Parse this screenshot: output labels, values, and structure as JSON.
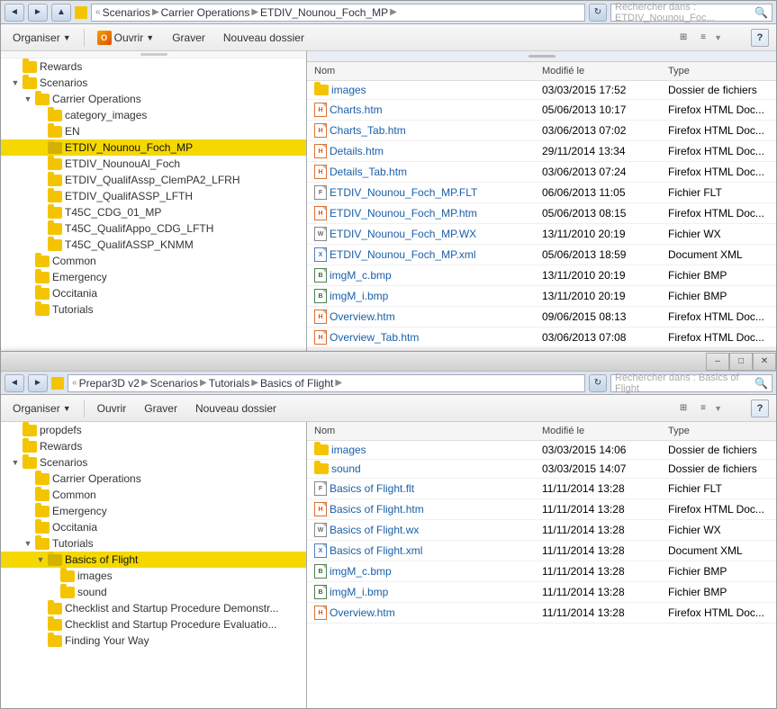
{
  "window1": {
    "addr": {
      "part1": "Scenarios",
      "part2": "Carrier Operations",
      "part3": "ETDIV_Nounou_Foch_MP",
      "search_placeholder": "Rechercher dans : ETDIV_Nounou_Foc..."
    },
    "toolbar": {
      "organiser": "Organiser",
      "ouvrir": "Ouvrir",
      "graver": "Graver",
      "nouveau_dossier": "Nouveau dossier"
    },
    "tree": {
      "items": [
        {
          "label": "Rewards",
          "indent": 1,
          "type": "folder"
        },
        {
          "label": "Scenarios",
          "indent": 1,
          "type": "folder",
          "expanded": true
        },
        {
          "label": "Carrier Operations",
          "indent": 2,
          "type": "folder",
          "expanded": true
        },
        {
          "label": "category_images",
          "indent": 3,
          "type": "folder"
        },
        {
          "label": "EN",
          "indent": 3,
          "type": "folder"
        },
        {
          "label": "ETDIV_Nounou_Foch_MP",
          "indent": 3,
          "type": "folder",
          "selected": true
        },
        {
          "label": "ETDIV_NounouAl_Foch",
          "indent": 3,
          "type": "folder"
        },
        {
          "label": "ETDIV_QualifAssp_ClemPA2_LFRH",
          "indent": 3,
          "type": "folder"
        },
        {
          "label": "ETDIV_QualifASSP_LFTH",
          "indent": 3,
          "type": "folder"
        },
        {
          "label": "T45C_CDG_01_MP",
          "indent": 3,
          "type": "folder"
        },
        {
          "label": "T45C_QualifAppo_CDG_LFTH",
          "indent": 3,
          "type": "folder"
        },
        {
          "label": "T45C_QualifASSP_KNMM",
          "indent": 3,
          "type": "folder"
        },
        {
          "label": "Common",
          "indent": 2,
          "type": "folder"
        },
        {
          "label": "Emergency",
          "indent": 2,
          "type": "folder"
        },
        {
          "label": "Occitania",
          "indent": 2,
          "type": "folder"
        },
        {
          "label": "Tutorials",
          "indent": 2,
          "type": "folder"
        }
      ]
    },
    "files": {
      "columns": [
        "Nom",
        "Modifié le",
        "Type"
      ],
      "rows": [
        {
          "name": "images",
          "date": "03/03/2015 17:52",
          "type": "Dossier de fichiers",
          "icon": "folder"
        },
        {
          "name": "Charts.htm",
          "date": "05/06/2013 10:17",
          "type": "Firefox HTML Doc...",
          "icon": "html"
        },
        {
          "name": "Charts_Tab.htm",
          "date": "03/06/2013 07:02",
          "type": "Firefox HTML Doc...",
          "icon": "html"
        },
        {
          "name": "Details.htm",
          "date": "29/11/2014 13:34",
          "type": "Firefox HTML Doc...",
          "icon": "html"
        },
        {
          "name": "Details_Tab.htm",
          "date": "03/06/2013 07:24",
          "type": "Firefox HTML Doc...",
          "icon": "html"
        },
        {
          "name": "ETDIV_Nounou_Foch_MP.FLT",
          "date": "06/06/2013 11:05",
          "type": "Fichier FLT",
          "icon": "flt"
        },
        {
          "name": "ETDIV_Nounou_Foch_MP.htm",
          "date": "05/06/2013 08:15",
          "type": "Firefox HTML Doc...",
          "icon": "html"
        },
        {
          "name": "ETDIV_Nounou_Foch_MP.WX",
          "date": "13/11/2010 20:19",
          "type": "Fichier WX",
          "icon": "wx"
        },
        {
          "name": "ETDIV_Nounou_Foch_MP.xml",
          "date": "05/06/2013 18:59",
          "type": "Document XML",
          "icon": "xml"
        },
        {
          "name": "imgM_c.bmp",
          "date": "13/11/2010 20:19",
          "type": "Fichier BMP",
          "icon": "bmp"
        },
        {
          "name": "imgM_i.bmp",
          "date": "13/11/2010 20:19",
          "type": "Fichier BMP",
          "icon": "bmp"
        },
        {
          "name": "Overview.htm",
          "date": "09/06/2015 08:13",
          "type": "Firefox HTML Doc...",
          "icon": "html"
        },
        {
          "name": "Overview_Tab.htm",
          "date": "03/06/2013 07:08",
          "type": "Firefox HTML Doc...",
          "icon": "html"
        }
      ]
    }
  },
  "window2": {
    "addr": {
      "part1": "Prepar3D v2",
      "part2": "Scenarios",
      "part3": "Tutorials",
      "part4": "Basics of Flight",
      "search_placeholder": "Rechercher dans : Basics of Flight"
    },
    "toolbar": {
      "organiser": "Organiser",
      "ouvrir": "Ouvrir",
      "graver": "Graver",
      "nouveau_dossier": "Nouveau dossier"
    },
    "tree": {
      "items": [
        {
          "label": "propdefs",
          "indent": 1,
          "type": "folder"
        },
        {
          "label": "Rewards",
          "indent": 1,
          "type": "folder"
        },
        {
          "label": "Scenarios",
          "indent": 1,
          "type": "folder",
          "expanded": true
        },
        {
          "label": "Carrier Operations",
          "indent": 2,
          "type": "folder"
        },
        {
          "label": "Common",
          "indent": 2,
          "type": "folder"
        },
        {
          "label": "Emergency",
          "indent": 2,
          "type": "folder"
        },
        {
          "label": "Occitania",
          "indent": 2,
          "type": "folder"
        },
        {
          "label": "Tutorials",
          "indent": 2,
          "type": "folder",
          "expanded": true
        },
        {
          "label": "Basics of Flight",
          "indent": 3,
          "type": "folder",
          "selected": true
        },
        {
          "label": "images",
          "indent": 4,
          "type": "folder"
        },
        {
          "label": "sound",
          "indent": 4,
          "type": "folder"
        },
        {
          "label": "Checklist and Startup Procedure Demonstr...",
          "indent": 3,
          "type": "folder"
        },
        {
          "label": "Checklist and Startup Procedure Evaluatio...",
          "indent": 3,
          "type": "folder"
        },
        {
          "label": "Finding Your Way",
          "indent": 3,
          "type": "folder"
        }
      ]
    },
    "files": {
      "columns": [
        "Nom",
        "Modifié le",
        "Type"
      ],
      "rows": [
        {
          "name": "images",
          "date": "03/03/2015 14:06",
          "type": "Dossier de fichiers",
          "icon": "folder"
        },
        {
          "name": "sound",
          "date": "03/03/2015 14:07",
          "type": "Dossier de fichiers",
          "icon": "folder"
        },
        {
          "name": "Basics of Flight.flt",
          "date": "11/11/2014 13:28",
          "type": "Fichier FLT",
          "icon": "flt"
        },
        {
          "name": "Basics of Flight.htm",
          "date": "11/11/2014 13:28",
          "type": "Firefox HTML Doc...",
          "icon": "html"
        },
        {
          "name": "Basics of Flight.wx",
          "date": "11/11/2014 13:28",
          "type": "Fichier WX",
          "icon": "wx"
        },
        {
          "name": "Basics of Flight.xml",
          "date": "11/11/2014 13:28",
          "type": "Document XML",
          "icon": "xml"
        },
        {
          "name": "imgM_c.bmp",
          "date": "11/11/2014 13:28",
          "type": "Fichier BMP",
          "icon": "bmp"
        },
        {
          "name": "imgM_i.bmp",
          "date": "11/11/2014 13:28",
          "type": "Fichier BMP",
          "icon": "bmp"
        },
        {
          "name": "Overview.htm",
          "date": "11/11/2014 13:28",
          "type": "Firefox HTML Doc...",
          "icon": "html"
        }
      ]
    }
  }
}
